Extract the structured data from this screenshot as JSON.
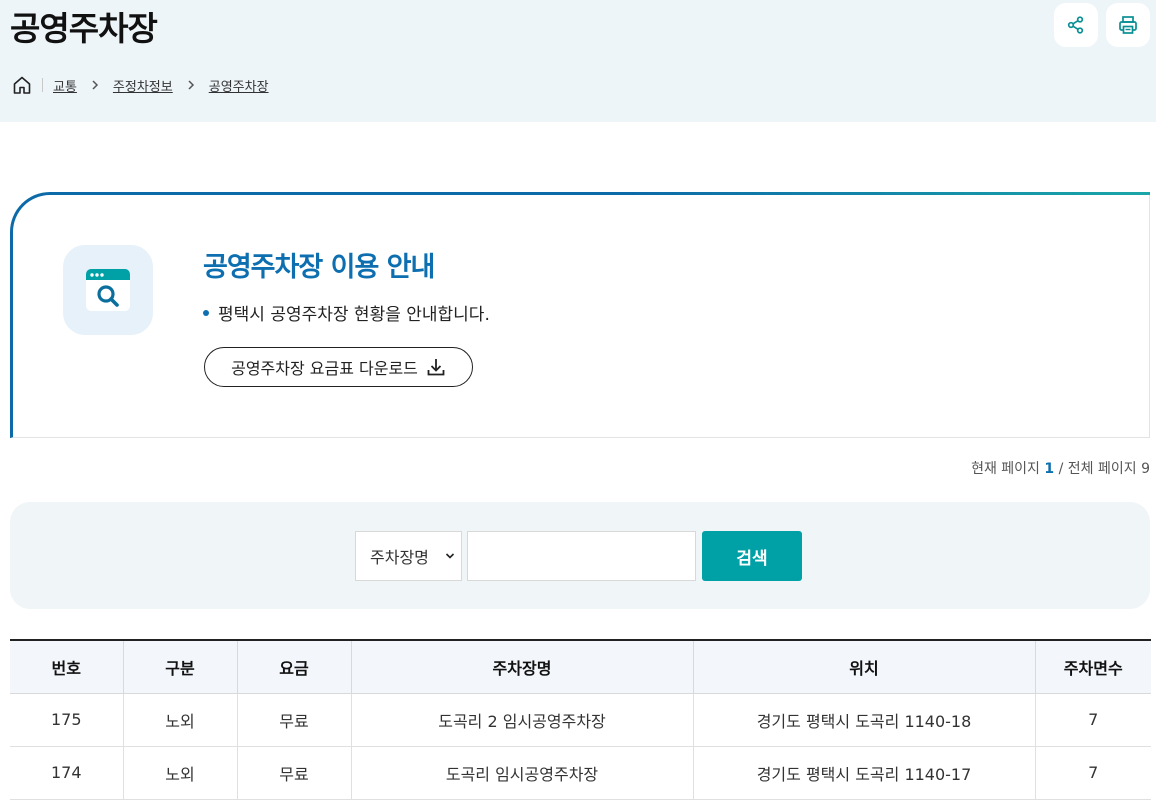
{
  "header": {
    "title": "공영주차장",
    "share_icon": "share-icon",
    "print_icon": "print-icon"
  },
  "breadcrumb": {
    "home_icon": "home-icon",
    "items": [
      "교통",
      "주정차정보",
      "공영주차장"
    ]
  },
  "guide": {
    "icon": "browser-search-icon",
    "title": "공영주차장 이용 안내",
    "description": "평택시 공영주차장 현황을 안내합니다.",
    "download_label": "공영주차장 요금표 다운로드",
    "download_icon": "download-icon"
  },
  "pagination": {
    "current_label": "현재 페이지",
    "current": "1",
    "total_label": "/ 전체 페이지",
    "total": "9"
  },
  "search": {
    "select_value": "주차장명",
    "input_value": "",
    "button_label": "검색"
  },
  "table": {
    "headers": [
      "번호",
      "구분",
      "요금",
      "주차장명",
      "위치",
      "주차면수"
    ],
    "rows": [
      [
        "175",
        "노외",
        "무료",
        "도곡리 2 임시공영주차장",
        "경기도 평택시 도곡리 1140-18",
        "7"
      ],
      [
        "174",
        "노외",
        "무료",
        "도곡리 임시공영주차장",
        "경기도 평택시 도곡리 1140-17",
        "7"
      ]
    ]
  },
  "colors": {
    "header_bg": "#eef5f9",
    "accent_blue": "#0d6fb0",
    "accent_teal": "#00a1a6",
    "search_bg": "#f0f5f8"
  }
}
